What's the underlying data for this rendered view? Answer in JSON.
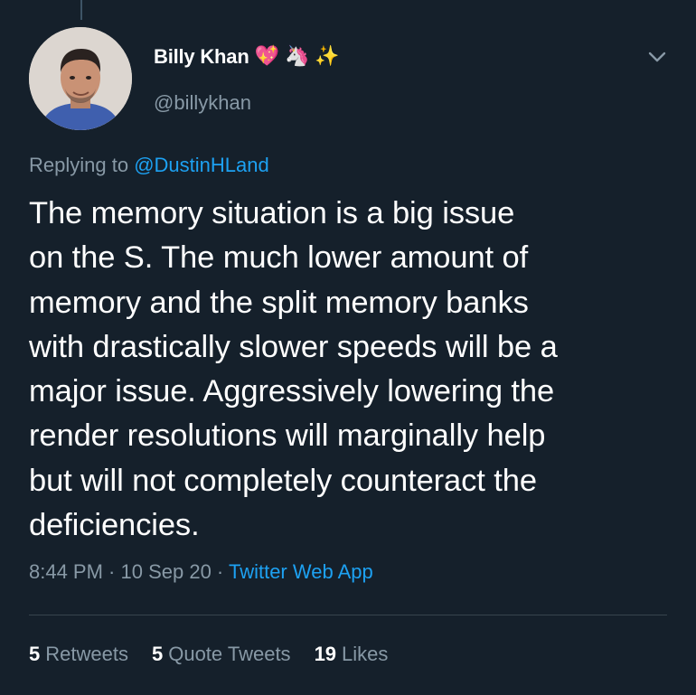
{
  "author": {
    "display_name": "Billy Khan",
    "emojis": [
      "💖",
      "🦄",
      "✨"
    ],
    "handle": "@billykhan"
  },
  "reply": {
    "prefix": "Replying to ",
    "mention": "@DustinHLand"
  },
  "tweet": {
    "text": "The memory situation is a big issue\non the S.   The much lower amount of\nmemory and the split memory banks\nwith drastically slower speeds will be a\nmajor issue.  Aggressively lowering the\nrender resolutions will marginally help\nbut will not completely counteract the\ndeficiencies."
  },
  "meta": {
    "time": "8:44 PM",
    "sep1": " · ",
    "date": "10 Sep 20",
    "sep2": " · ",
    "source": "Twitter Web App"
  },
  "stats": {
    "retweets_count": "5",
    "retweets_label": "Retweets",
    "quotes_count": "5",
    "quotes_label": "Quote Tweets",
    "likes_count": "19",
    "likes_label": "Likes"
  },
  "colors": {
    "background": "#15202b",
    "accent": "#1da1f2",
    "secondary_text": "#8899a6",
    "divider": "#38444d"
  },
  "icons": {
    "more": "chevron-down-icon"
  }
}
